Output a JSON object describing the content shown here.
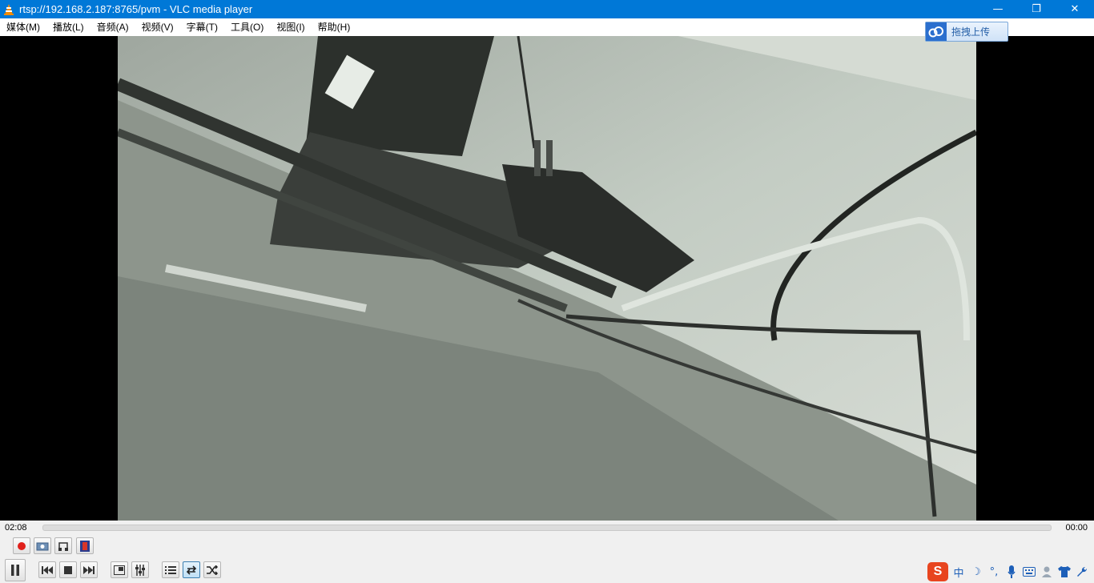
{
  "window": {
    "title": "rtsp://192.168.2.187:8765/pvm - VLC media player",
    "minimize_glyph": "—",
    "restore_glyph": "❐",
    "close_glyph": "✕"
  },
  "menu": {
    "items": [
      {
        "label": "媒体(M)"
      },
      {
        "label": "播放(L)"
      },
      {
        "label": "音频(A)"
      },
      {
        "label": "视频(V)"
      },
      {
        "label": "字幕(T)"
      },
      {
        "label": "工具(O)"
      },
      {
        "label": "视图(I)"
      },
      {
        "label": "帮助(H)"
      }
    ]
  },
  "upload_badge": {
    "label": "拖拽上传"
  },
  "playback": {
    "elapsed": "02:08",
    "total": "00:00"
  },
  "tray": {
    "ime_brand": "S",
    "ime_mode": "中",
    "moon_glyph": "☽",
    "punct_glyph": "°,"
  },
  "colors": {
    "titlebar": "#0078d7",
    "record": "#e0201b",
    "active_button": "#bfe0f5"
  }
}
